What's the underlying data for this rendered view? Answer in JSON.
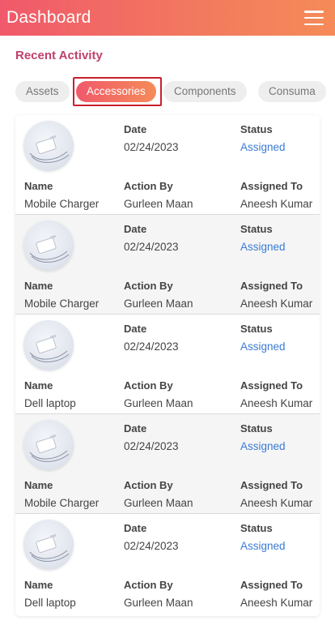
{
  "header": {
    "title": "Dashboard",
    "menu_icon": "hamburger-menu-icon"
  },
  "section": {
    "title": "Recent Activity"
  },
  "tabs": [
    {
      "label": "Assets",
      "active": false
    },
    {
      "label": "Accessories",
      "active": true
    },
    {
      "label": "Components",
      "active": false
    },
    {
      "label": "Consuma",
      "active": false
    }
  ],
  "labels": {
    "date": "Date",
    "status": "Status",
    "name": "Name",
    "action_by": "Action By",
    "assigned_to": "Assigned To"
  },
  "items": [
    {
      "date": "02/24/2023",
      "status": "Assigned",
      "name": "Mobile Charger",
      "action_by": "Gurleen Maan",
      "assigned_to": "Aneesh Kumar",
      "image": "charger-icon"
    },
    {
      "date": "02/24/2023",
      "status": "Assigned",
      "name": "Mobile Charger",
      "action_by": "Gurleen Maan",
      "assigned_to": "Aneesh Kumar",
      "image": "charger-icon"
    },
    {
      "date": "02/24/2023",
      "status": "Assigned",
      "name": "Dell laptop",
      "action_by": "Gurleen Maan",
      "assigned_to": "Aneesh Kumar",
      "image": "charger-icon"
    },
    {
      "date": "02/24/2023",
      "status": "Assigned",
      "name": "Mobile Charger",
      "action_by": "Gurleen Maan",
      "assigned_to": "Aneesh Kumar",
      "image": "charger-icon"
    },
    {
      "date": "02/24/2023",
      "status": "Assigned",
      "name": "Dell laptop",
      "action_by": "Gurleen Maan",
      "assigned_to": "Aneesh Kumar",
      "image": "charger-icon"
    }
  ],
  "colors": {
    "header_gradient_start": "#f0596b",
    "header_gradient_end": "#f58b58",
    "section_title": "#c0416b",
    "status_text": "#3a7bd5",
    "highlight_border": "#c8202c"
  }
}
